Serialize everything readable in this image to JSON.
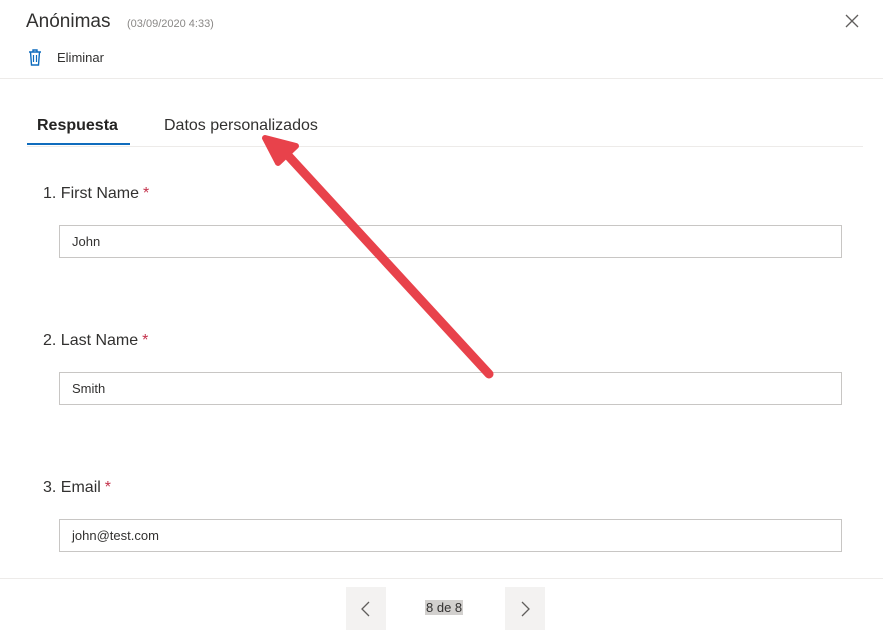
{
  "header": {
    "title": "Anónimas",
    "timestamp": "(03/09/2020 4:33)",
    "delete_label": "Eliminar"
  },
  "tabs": [
    {
      "label": "Respuesta",
      "selected": true
    },
    {
      "label": "Datos personalizados",
      "selected": false
    }
  ],
  "questions": [
    {
      "label": "1. First Name",
      "required_mark": "*",
      "value": "John"
    },
    {
      "label": "2. Last Name",
      "required_mark": "*",
      "value": "Smith"
    },
    {
      "label": "3. Email",
      "required_mark": "*",
      "value": "john@test.com"
    }
  ],
  "pager": {
    "indicator": "8 de 8"
  },
  "icons": {
    "close": "close-icon",
    "delete": "trash-icon",
    "prev": "chevron-left-icon",
    "next": "chevron-right-icon"
  },
  "colors": {
    "accent": "#0f6cbd",
    "required": "#c4314b",
    "arrow": "#e8424b"
  }
}
